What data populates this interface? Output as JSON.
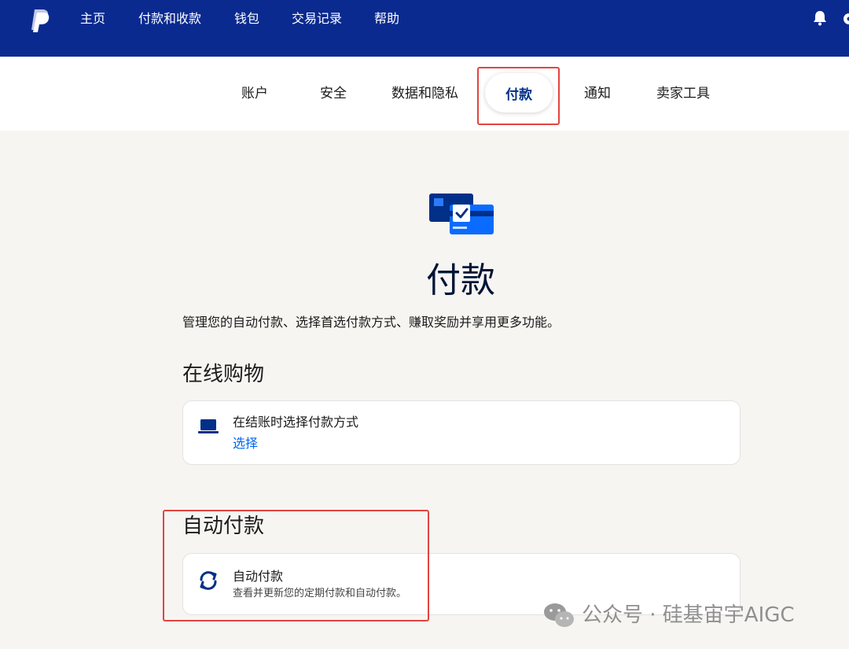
{
  "top_nav": {
    "items": [
      "主页",
      "付款和收款",
      "钱包",
      "交易记录",
      "帮助"
    ],
    "logo": "paypal-logo-icon",
    "right_icons": [
      "bell-icon",
      "gear-icon"
    ]
  },
  "sub_nav": {
    "items": [
      "账户",
      "安全",
      "数据和隐私",
      "付款",
      "通知",
      "卖家工具"
    ],
    "active": "付款"
  },
  "hero": {
    "icon": "payment-cards-icon",
    "title": "付款",
    "description": "管理您的自动付款、选择首选付款方式、赚取奖励并享用更多功能。"
  },
  "online_shopping": {
    "section_title": "在线购物",
    "card": {
      "icon": "laptop-icon",
      "title": "在结账时选择付款方式",
      "link": "选择"
    }
  },
  "auto_pay": {
    "section_title": "自动付款",
    "card": {
      "icon": "refresh-icon",
      "title": "自动付款",
      "subtitle": "查看并更新您的定期付款和自动付款。"
    }
  },
  "watermark": {
    "text": "公众号 · 硅基宙宇AIGC",
    "icon": "wechat-icon"
  },
  "colors": {
    "nav_bg": "#0a2a8f",
    "accent_blue": "#0066f5",
    "highlight_red": "#e4443f",
    "page_bg": "#f6f5f2"
  }
}
